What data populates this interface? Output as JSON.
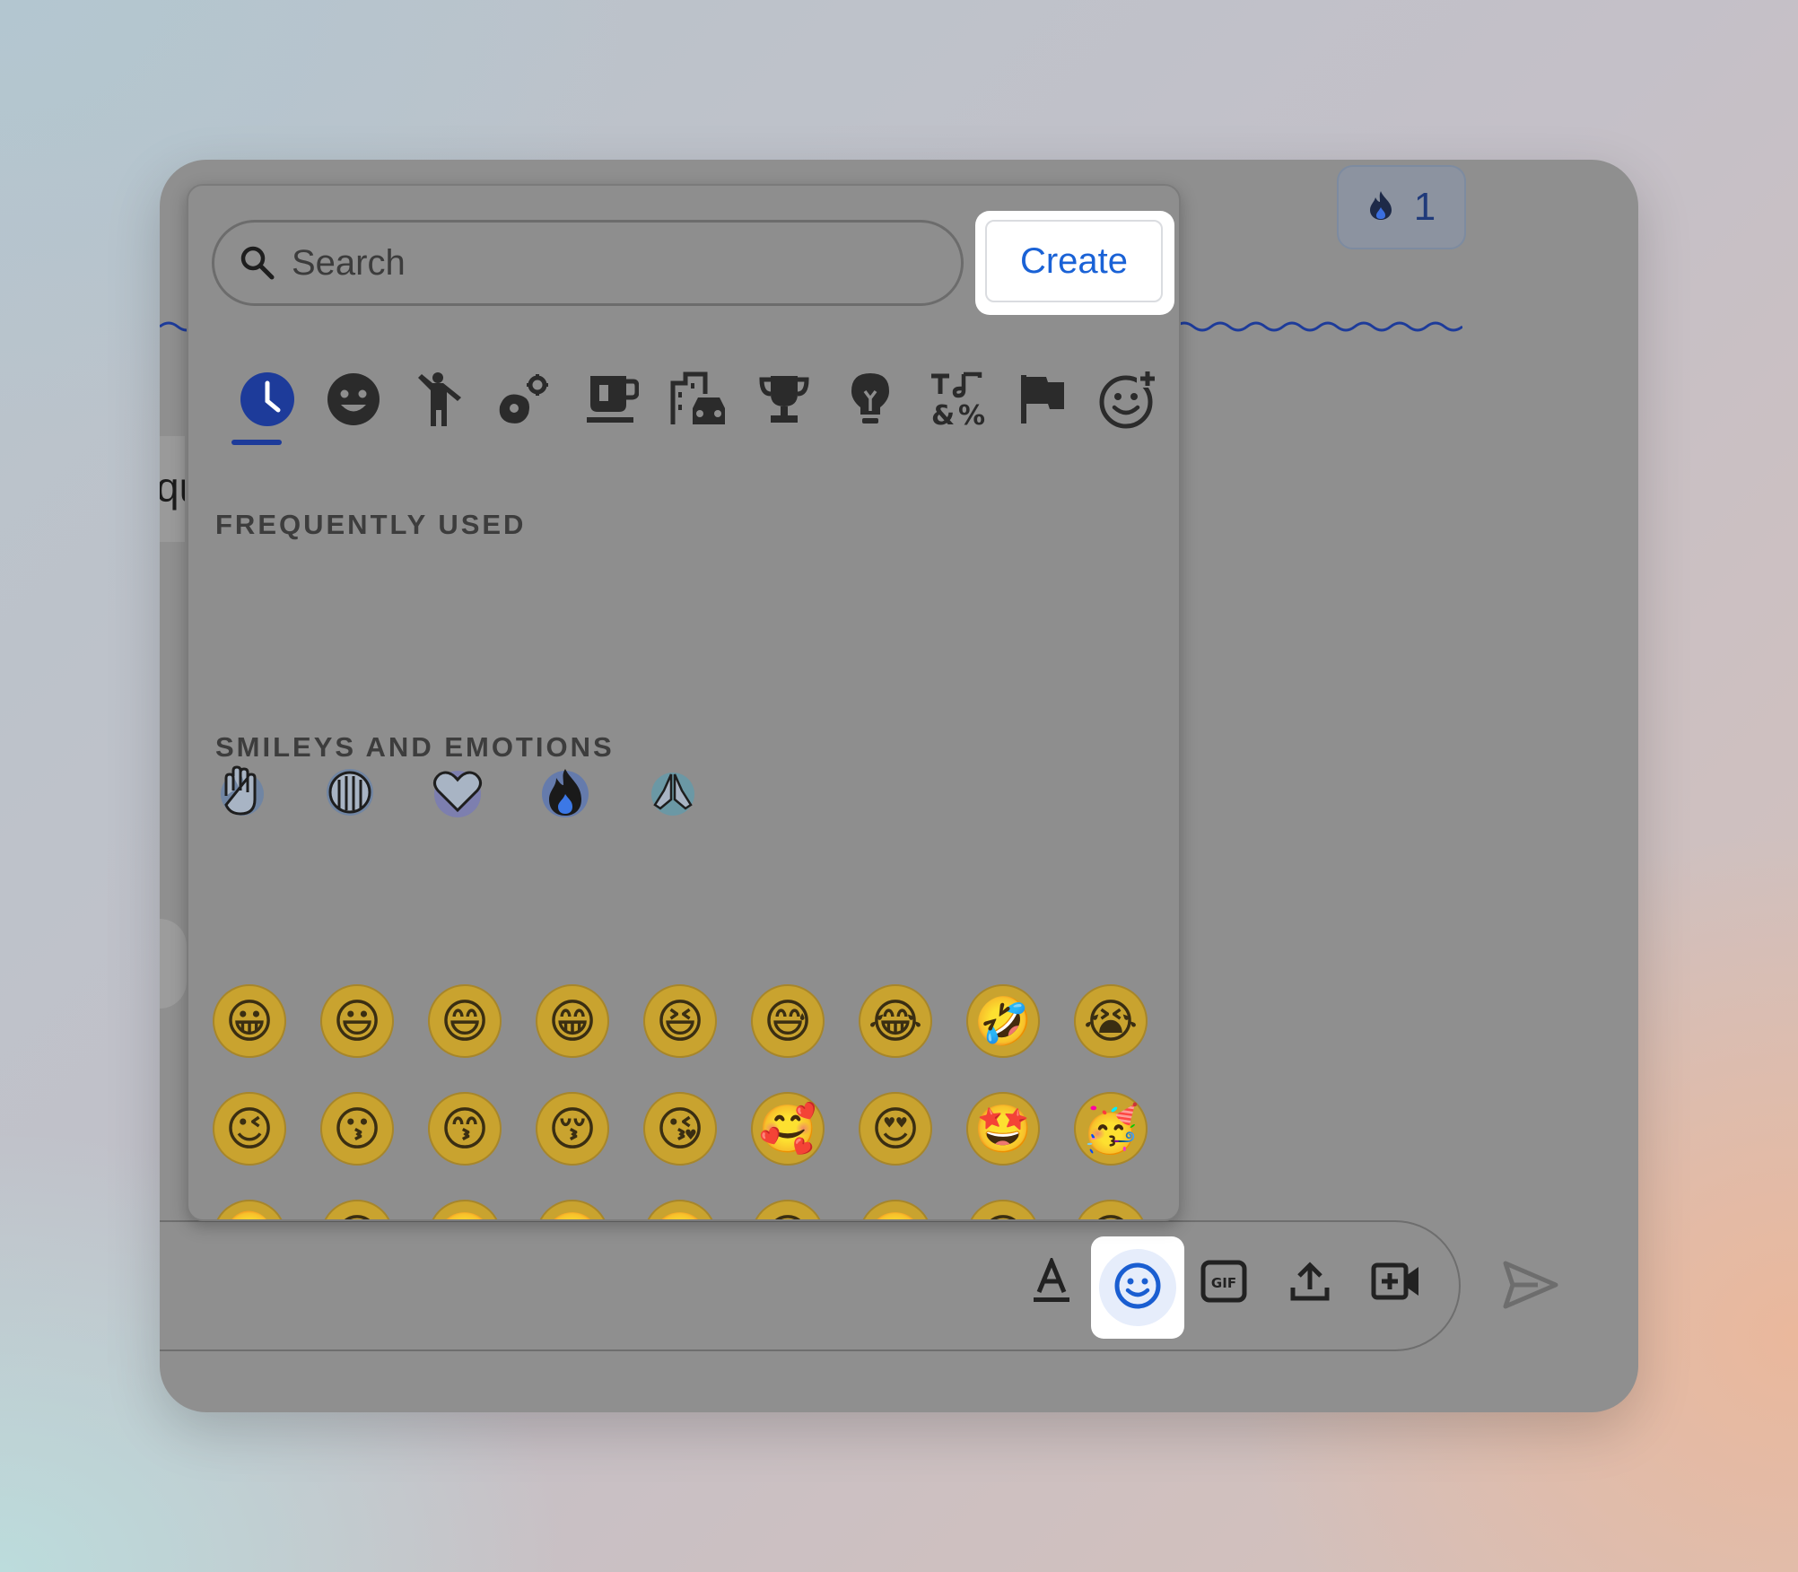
{
  "reaction": {
    "icon": "fire-icon",
    "count": "1"
  },
  "partial_text": "qu",
  "picker": {
    "search_placeholder": "Search",
    "create_label": "Create",
    "categories": [
      {
        "name": "recent",
        "icon": "clock-icon"
      },
      {
        "name": "smileys",
        "icon": "smiley-icon"
      },
      {
        "name": "people",
        "icon": "person-icon"
      },
      {
        "name": "nature",
        "icon": "flower-icon"
      },
      {
        "name": "food",
        "icon": "cup-icon"
      },
      {
        "name": "travel",
        "icon": "buildings-icon"
      },
      {
        "name": "activities",
        "icon": "trophy-icon"
      },
      {
        "name": "objects",
        "icon": "lightbulb-icon"
      },
      {
        "name": "symbols",
        "icon": "symbols-icon"
      },
      {
        "name": "flags",
        "icon": "flag-icon"
      },
      {
        "name": "custom",
        "icon": "add-emoji-icon"
      }
    ],
    "frequently_used_title": "FREQUENTLY USED",
    "frequently_used": [
      "high-five-icon",
      "crying-hands-icon",
      "heart-icon",
      "fire-icon",
      "praying-hands-icon"
    ],
    "smileys_title": "SMILEYS AND EMOTIONS",
    "smileys": [
      "😀",
      "😃",
      "😄",
      "😁",
      "😆",
      "😅",
      "😂",
      "🤣",
      "😭",
      "😉",
      "😗",
      "😙",
      "😚",
      "😘",
      "🥰",
      "😍",
      "🤩",
      "🥳",
      "🫠",
      "🙃",
      "🙂",
      "🥲",
      "🥹",
      "😊",
      "☺️",
      "😌",
      "😏",
      "😴",
      "😪",
      "🤤",
      "😋",
      "😛",
      "😝",
      "😜",
      "🤪",
      "🥴"
    ]
  },
  "toolbar": [
    {
      "name": "format-text-icon"
    },
    {
      "name": "emoji-icon"
    },
    {
      "name": "gif-icon"
    },
    {
      "name": "upload-icon"
    },
    {
      "name": "video-meeting-icon"
    }
  ],
  "send_icon": "send-icon",
  "colors": {
    "accent": "#1a62d6",
    "dim_overlay": "#8e8e8e"
  }
}
